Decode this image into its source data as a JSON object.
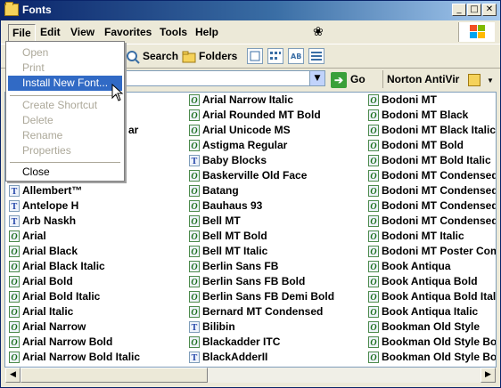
{
  "window": {
    "title": "Fonts"
  },
  "menubar": {
    "items": [
      "File",
      "Edit",
      "View",
      "Favorites",
      "Tools",
      "Help"
    ]
  },
  "toolbar": {
    "search_label": "Search",
    "folders_label": "Folders"
  },
  "addressbar": {
    "go_label": "Go",
    "norton_label": "Norton AntiVir"
  },
  "file_menu": {
    "items": [
      {
        "label": "Open",
        "enabled": false
      },
      {
        "label": "Print",
        "enabled": false
      },
      {
        "label": "Install New Font...",
        "enabled": true,
        "highlighted": true
      },
      {
        "label": "Create Shortcut",
        "enabled": false
      },
      {
        "label": "Delete",
        "enabled": false
      },
      {
        "label": "Rename",
        "enabled": false
      },
      {
        "label": "Properties",
        "enabled": false
      },
      {
        "label": "Close",
        "enabled": true
      }
    ]
  },
  "fonts": {
    "col1_visible_fragment": "ar",
    "col1": [
      {
        "name": "Allembert™",
        "type": "t"
      },
      {
        "name": "Antelope H",
        "type": "t"
      },
      {
        "name": "Arb Naskh",
        "type": "t"
      },
      {
        "name": "Arial",
        "type": "o"
      },
      {
        "name": "Arial Black",
        "type": "o"
      },
      {
        "name": "Arial Black Italic",
        "type": "o"
      },
      {
        "name": "Arial Bold",
        "type": "o"
      },
      {
        "name": "Arial Bold Italic",
        "type": "o"
      },
      {
        "name": "Arial Italic",
        "type": "o"
      },
      {
        "name": "Arial Narrow",
        "type": "o"
      },
      {
        "name": "Arial Narrow Bold",
        "type": "o"
      },
      {
        "name": "Arial Narrow Bold Italic",
        "type": "o"
      }
    ],
    "col2": [
      {
        "name": "Arial Narrow Italic",
        "type": "o"
      },
      {
        "name": "Arial Rounded MT Bold",
        "type": "o"
      },
      {
        "name": "Arial Unicode MS",
        "type": "o"
      },
      {
        "name": "Astigma Regular",
        "type": "o"
      },
      {
        "name": "Baby Blocks",
        "type": "t"
      },
      {
        "name": "Baskerville Old Face",
        "type": "o"
      },
      {
        "name": "Batang",
        "type": "o"
      },
      {
        "name": "Bauhaus 93",
        "type": "o"
      },
      {
        "name": "Bell MT",
        "type": "o"
      },
      {
        "name": "Bell MT Bold",
        "type": "o"
      },
      {
        "name": "Bell MT Italic",
        "type": "o"
      },
      {
        "name": "Berlin Sans FB",
        "type": "o"
      },
      {
        "name": "Berlin Sans FB Bold",
        "type": "o"
      },
      {
        "name": "Berlin Sans FB Demi Bold",
        "type": "o"
      },
      {
        "name": "Bernard MT Condensed",
        "type": "o"
      },
      {
        "name": "Bilibin",
        "type": "t"
      },
      {
        "name": "Blackadder ITC",
        "type": "o"
      },
      {
        "name": "BlackAdderII",
        "type": "t"
      }
    ],
    "col3": [
      {
        "name": "Bodoni MT",
        "type": "o"
      },
      {
        "name": "Bodoni MT Black",
        "type": "o"
      },
      {
        "name": "Bodoni MT Black Italic",
        "type": "o"
      },
      {
        "name": "Bodoni MT Bold",
        "type": "o"
      },
      {
        "name": "Bodoni MT Bold Italic",
        "type": "o"
      },
      {
        "name": "Bodoni MT Condensed",
        "type": "o"
      },
      {
        "name": "Bodoni MT Condensed B",
        "type": "o"
      },
      {
        "name": "Bodoni MT Condensed B",
        "type": "o"
      },
      {
        "name": "Bodoni MT Condensed I",
        "type": "o"
      },
      {
        "name": "Bodoni MT Italic",
        "type": "o"
      },
      {
        "name": "Bodoni MT Poster Comp",
        "type": "o"
      },
      {
        "name": "Book Antiqua",
        "type": "o"
      },
      {
        "name": "Book Antiqua Bold",
        "type": "o"
      },
      {
        "name": "Book Antiqua Bold Italic",
        "type": "o"
      },
      {
        "name": "Book Antiqua Italic",
        "type": "o"
      },
      {
        "name": "Bookman Old Style",
        "type": "o"
      },
      {
        "name": "Bookman Old Style Bold",
        "type": "o"
      },
      {
        "name": "Bookman Old Style Bold",
        "type": "o"
      }
    ]
  },
  "colors": {
    "title_start": "#0a246a",
    "title_end": "#a6caf0",
    "highlight": "#316ac5",
    "window_bg": "#ece9d8"
  },
  "icons": {
    "truetype": "T",
    "opentype": "O",
    "minimize": "_",
    "maximize": "□",
    "close": "✕",
    "go": "➔",
    "dropdown": "▼",
    "scroll_left": "◀",
    "scroll_right": "▶",
    "throbber": "❀",
    "cursor": "↖"
  }
}
